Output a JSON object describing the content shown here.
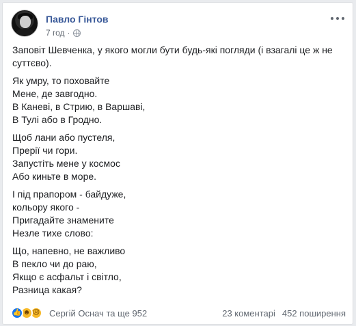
{
  "post": {
    "author": "Павло Гінтов",
    "time": "7 год",
    "separator": "·",
    "paragraphs": [
      "Заповіт Шевченка, у якого могли бути будь-які погляди (і взагалі це ж не суттєво).",
      "Як умру, то поховайте\nМене, де завгодно.\nВ Каневі, в Стрию, в Варшаві,\nВ Тулі або в Гродно.",
      "Щоб лани або пустеля,\nПрерії чи гори.\nЗапустіть мене у космос\nАбо киньте в море.",
      "І під прапором - байдуже,\nкольору якого -\nПригадайте знамените\nНезле тихе слово:",
      "Що, напевно, не важливо\nВ пекло чи до раю,\nЯкщо є асфальт і світло,\nРазница какая?"
    ]
  },
  "footer": {
    "reactions": [
      "like-icon",
      "haha-icon",
      "sad-icon"
    ],
    "reactors": "Сергій Оснач та ще 952",
    "comments": "23 коментарі",
    "shares": "452 поширення"
  },
  "colors": {
    "name": "#385898",
    "like": "#1877f2",
    "emoji": "#f7b928"
  }
}
